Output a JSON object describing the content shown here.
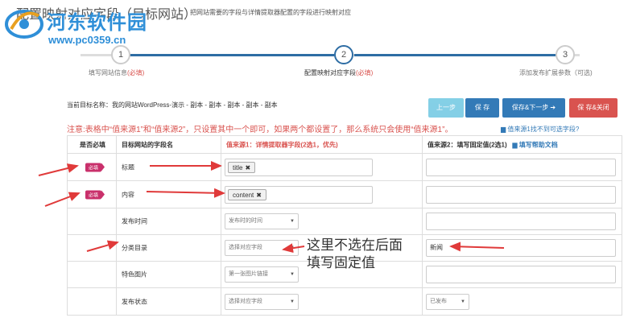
{
  "watermark": {
    "brand": "河东软件园",
    "url": "www.pc0359.cn"
  },
  "header": {
    "title": "配置映射对应字段（目标网站）",
    "description": "把网站需要的字段与详情提取器配置的字段进行映射对应"
  },
  "steps": [
    {
      "number": "1",
      "label": "填写网站信息",
      "required_mark": "(必填)"
    },
    {
      "number": "2",
      "label": "配置映射对应字段",
      "required_mark": "(必填)"
    },
    {
      "number": "3",
      "label": "添加发布扩展参数（可选)",
      "required_mark": ""
    }
  ],
  "current_target": "当前目标名称：我的网站WordPress-演示 - 副本 - 副本 - 副本 - 副本 - 副本",
  "toolbar": {
    "prev_label": "上一步",
    "save_label": "保 存",
    "save_next_label": "保存&下一步 ➔",
    "save_close_label": "保 存&关闭"
  },
  "notice": {
    "text": "注意:表格中“值来源1”和“值来源2”，只设置其中一个即可，如果两个都设置了，那么系统只会使用“值来源1”。",
    "link": "值来源1找不到可选字段?"
  },
  "table": {
    "headers": {
      "required": "是否必填",
      "field": "目标网站的字段名",
      "source1": "值来源1：详情提取器字段(2选1，优先)",
      "source2": "值来源2：填写固定值(2选1)",
      "help_link": "填写帮助文档"
    },
    "rows": [
      {
        "badge": "必填",
        "field": "标题",
        "tag": "title",
        "tag_remove": "✖",
        "fixed": ""
      },
      {
        "badge": "必填",
        "field": "内容",
        "tag": "content",
        "tag_remove": "✖",
        "fixed": ""
      },
      {
        "badge": "",
        "field": "发布时间",
        "select": "发布时的时间",
        "fixed": ""
      },
      {
        "badge": "",
        "field": "分类目录",
        "select": "选择对应字段",
        "fixed": "新闻"
      },
      {
        "badge": "",
        "field": "特色图片",
        "select": "第一张图片链接",
        "fixed": ""
      },
      {
        "badge": "",
        "field": "发布状态",
        "select": "选择对应字段",
        "fixed_select": "已发布"
      }
    ]
  },
  "annotation": {
    "line1": "这里不选在后面",
    "line2": "填写固定值"
  },
  "colors": {
    "primary": "#337ab7",
    "danger": "#d9534f",
    "badge": "#c9306b",
    "arrow": "#e03a3a"
  }
}
